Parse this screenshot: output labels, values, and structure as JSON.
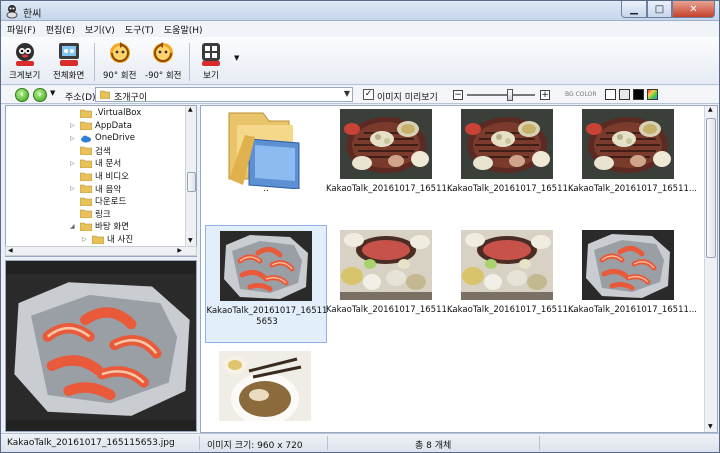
{
  "window": {
    "title": "한씨"
  },
  "menu": [
    "파일(F)",
    "편집(E)",
    "보기(V)",
    "도구(T)",
    "도움말(H)"
  ],
  "toolbar": {
    "fit": "크게보기",
    "fullscreen": "전체화면",
    "rotate_cw": "90° 회전",
    "rotate_ccw": "-90° 회전",
    "view": "보기"
  },
  "address": {
    "label": "주소(D)",
    "path": "조개구이",
    "preview_checkbox_label": "이미지 미리보기",
    "preview_checked": true,
    "zoom_level": 0.6,
    "color_label": "BG COLOR",
    "swatches": [
      "#ffffff",
      "#e8e8e8",
      "#000000",
      "#5a8fd8"
    ]
  },
  "tree": [
    {
      "label": ".VirtualBox",
      "expander": "",
      "icon": "folder-icon",
      "indent": 1
    },
    {
      "label": "AppData",
      "expander": "▷",
      "icon": "folder-icon",
      "indent": 1
    },
    {
      "label": "OneDrive",
      "expander": "▷",
      "icon": "cloud-icon",
      "indent": 1
    },
    {
      "label": "검색",
      "expander": "",
      "icon": "folder-icon",
      "indent": 1
    },
    {
      "label": "내 문서",
      "expander": "▷",
      "icon": "folder-icon",
      "indent": 1
    },
    {
      "label": "내 비디오",
      "expander": "",
      "icon": "folder-icon",
      "indent": 1
    },
    {
      "label": "내 음악",
      "expander": "▷",
      "icon": "folder-icon",
      "indent": 1
    },
    {
      "label": "다운로드",
      "expander": "",
      "icon": "folder-icon",
      "indent": 1
    },
    {
      "label": "링크",
      "expander": "",
      "icon": "folder-icon",
      "indent": 1
    },
    {
      "label": "바탕 화면",
      "expander": "◢",
      "icon": "folder-icon",
      "indent": 1
    },
    {
      "label": "내 사진",
      "expander": "▷",
      "icon": "folder-icon",
      "indent": 2
    }
  ],
  "files": [
    {
      "name": "..",
      "kind": "parent"
    },
    {
      "name": "KakaoTalk_20161017_16511...",
      "kind": "grill"
    },
    {
      "name": "KakaoTalk_20161017_16511...",
      "kind": "grill"
    },
    {
      "name": "KakaoTalk_20161017_16511...",
      "kind": "grill"
    },
    {
      "name": "KakaoTalk_20161017_165115653",
      "kind": "shrimp",
      "selected": true
    },
    {
      "name": "KakaoTalk_20161017_16511...",
      "kind": "table"
    },
    {
      "name": "KakaoTalk_20161017_16511...",
      "kind": "table"
    },
    {
      "name": "KakaoTalk_20161017_16511...",
      "kind": "shrimp"
    },
    {
      "name": "",
      "kind": "soup"
    }
  ],
  "status": {
    "filename": "KakaoTalk_20161017_165115653.jpg",
    "image_size": "이미지 크기: 960 x 720",
    "total": "총 8 개체"
  }
}
